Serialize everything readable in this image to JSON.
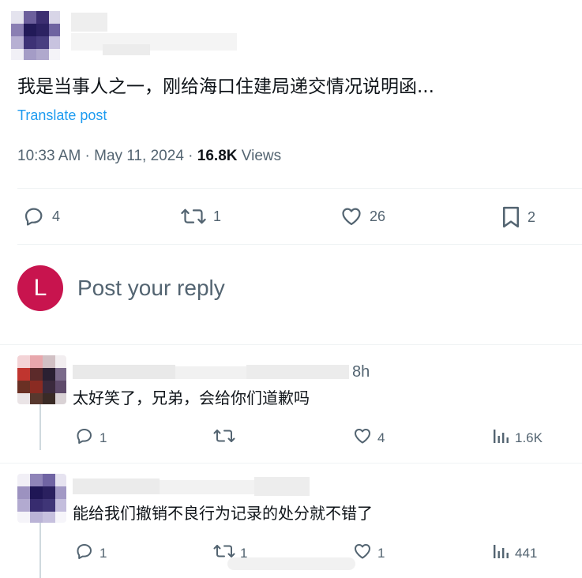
{
  "post": {
    "text": "我是当事人之一，刚给海口住建局递交情况说明函...",
    "translate_label": "Translate post",
    "time": "10:33 AM · May 11, 2024 · ",
    "views_count": "16.8K",
    "views_label": " Views",
    "stats": {
      "replies": "4",
      "reposts": "1",
      "likes": "26",
      "bookmarks": "2"
    }
  },
  "compose": {
    "avatar_letter": "L",
    "placeholder": "Post your reply"
  },
  "replies": [
    {
      "time": "8h",
      "text": "太好笑了，兄弟，会给你们道歉吗",
      "replies": "1",
      "reposts": "",
      "likes": "4",
      "views": "1.6K"
    },
    {
      "time": "",
      "text": "能给我们撤销不良行为记录的处分就不错了",
      "replies": "1",
      "reposts": "1",
      "likes": "1",
      "views": "441"
    }
  ],
  "colors": {
    "accent": "#1d9bf0",
    "text": "#0f1419",
    "muted": "#536471",
    "avatar": "#c8144e"
  }
}
